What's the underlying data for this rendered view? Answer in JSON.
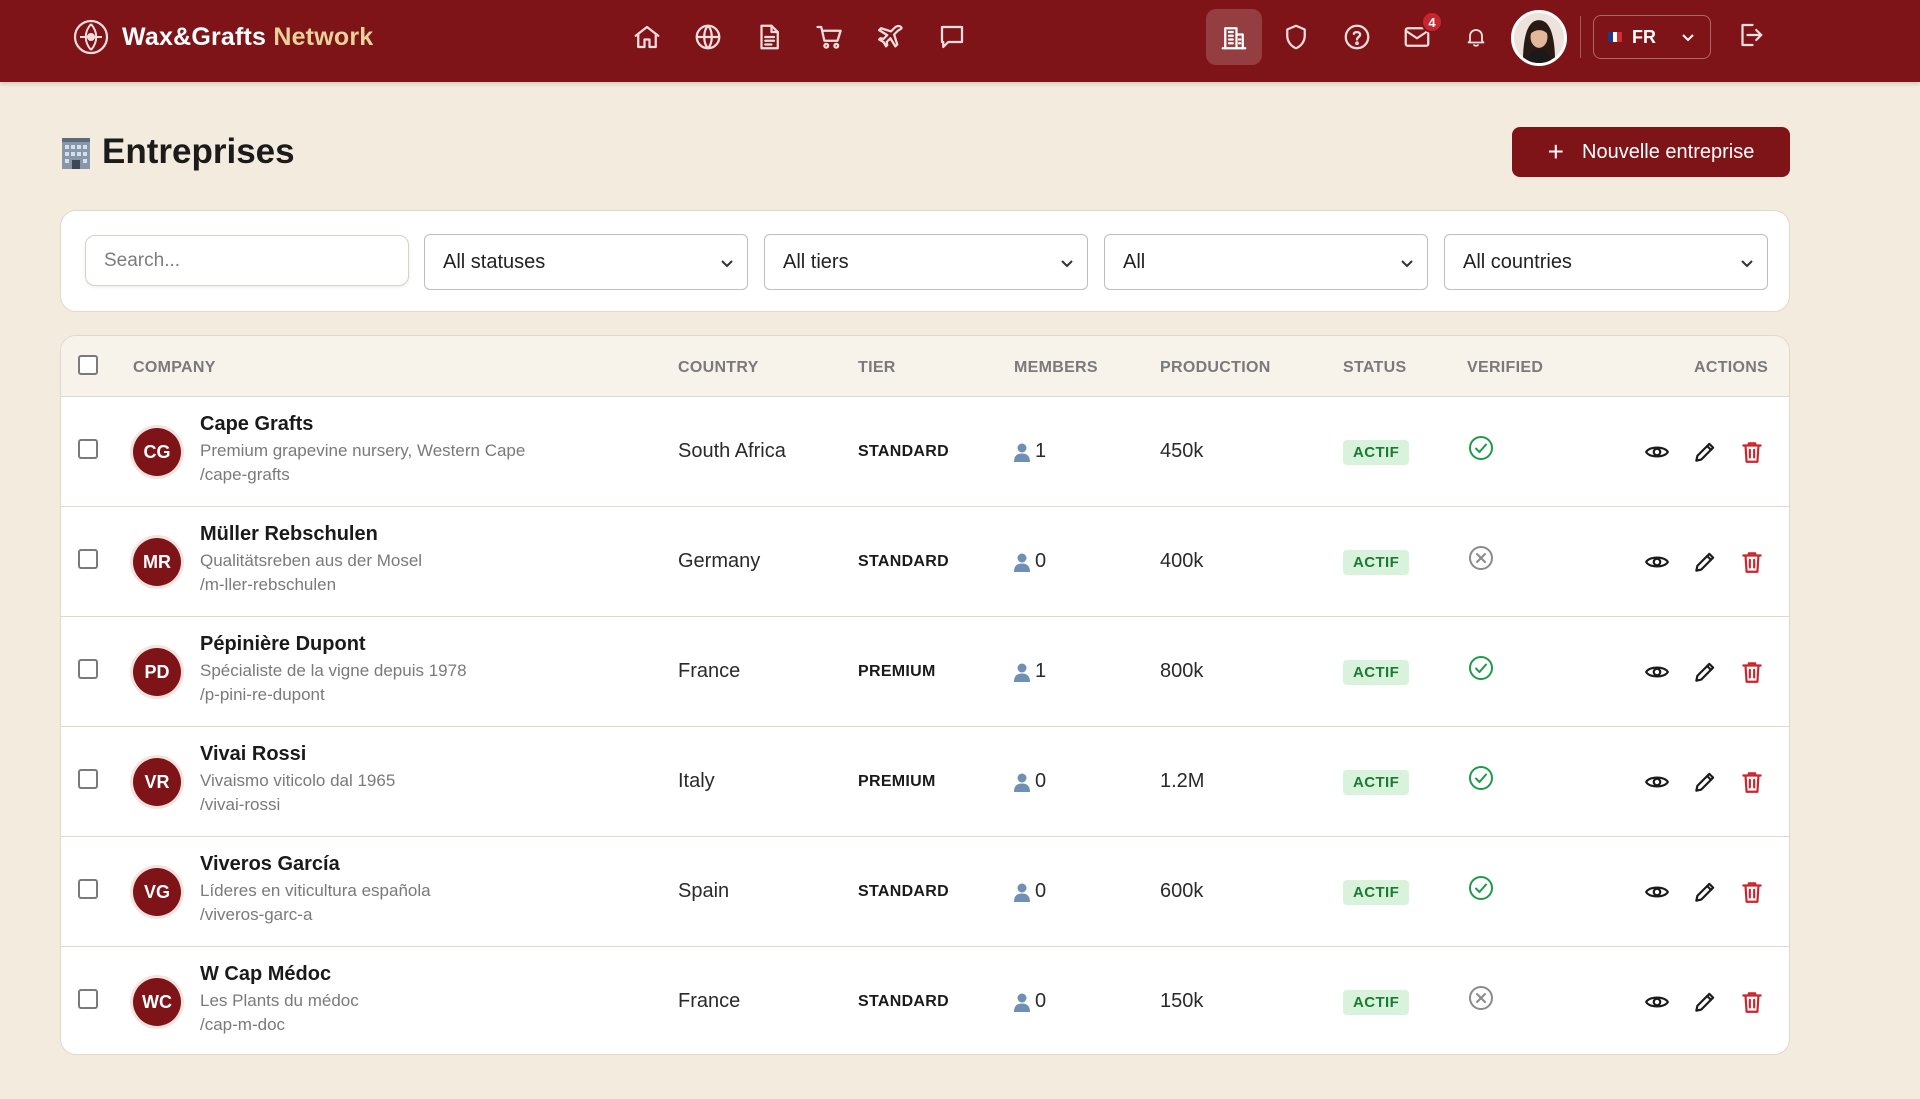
{
  "header": {
    "brand_primary": "Wax&Grafts",
    "brand_accent": "Network",
    "notifications_count": "4",
    "language": "FR",
    "nav_icons": [
      "home-icon",
      "globe-icon",
      "document-icon",
      "cart-icon",
      "plane-icon",
      "chat-icon",
      "building-icon",
      "shield-icon",
      "help-icon",
      "mail-icon",
      "bell-icon",
      "logout-icon"
    ]
  },
  "page": {
    "title": "Entreprises",
    "title_emoji": "building-emoji",
    "new_button_label": "Nouvelle entreprise"
  },
  "filters": {
    "search_placeholder": "Search...",
    "status": "All statuses",
    "tier": "All tiers",
    "verified": "All",
    "country": "All countries"
  },
  "table": {
    "headers": {
      "company": "COMPANY",
      "country": "COUNTRY",
      "tier": "TIER",
      "members": "MEMBERS",
      "production": "PRODUCTION",
      "status": "STATUS",
      "verified": "VERIFIED",
      "actions": "ACTIONS"
    },
    "rows": [
      {
        "initials": "CG",
        "name": "Cape Grafts",
        "description": "Premium grapevine nursery, Western Cape",
        "slug": "/cape-grafts",
        "country": "South Africa",
        "tier": "STANDARD",
        "members": "1",
        "production": "450k",
        "status": "ACTIF",
        "verified": true
      },
      {
        "initials": "MR",
        "name": "Müller Rebschulen",
        "description": "Qualitätsreben aus der Mosel",
        "slug": "/m-ller-rebschulen",
        "country": "Germany",
        "tier": "STANDARD",
        "members": "0",
        "production": "400k",
        "status": "ACTIF",
        "verified": false
      },
      {
        "initials": "PD",
        "name": "Pépinière Dupont",
        "description": "Spécialiste de la vigne depuis 1978",
        "slug": "/p-pini-re-dupont",
        "country": "France",
        "tier": "PREMIUM",
        "members": "1",
        "production": "800k",
        "status": "ACTIF",
        "verified": true
      },
      {
        "initials": "VR",
        "name": "Vivai Rossi",
        "description": "Vivaismo viticolo dal 1965",
        "slug": "/vivai-rossi",
        "country": "Italy",
        "tier": "PREMIUM",
        "members": "0",
        "production": "1.2M",
        "status": "ACTIF",
        "verified": true
      },
      {
        "initials": "VG",
        "name": "Viveros García",
        "description": "Líderes en viticultura española",
        "slug": "/viveros-garc-a",
        "country": "Spain",
        "tier": "STANDARD",
        "members": "0",
        "production": "600k",
        "status": "ACTIF",
        "verified": true
      },
      {
        "initials": "WC",
        "name": "W Cap Médoc",
        "description": "Les Plants du médoc",
        "slug": "/cap-m-doc",
        "country": "France",
        "tier": "STANDARD",
        "members": "0",
        "production": "150k",
        "status": "ACTIF",
        "verified": false
      }
    ]
  },
  "colors": {
    "brand": "#7e1418",
    "background": "#f3ebde",
    "status_bg": "#d9f2dc",
    "status_text": "#1b7a33",
    "verified": "#1e9a4a",
    "unverified": "#8a8a8a",
    "delete": "#c8262f"
  }
}
